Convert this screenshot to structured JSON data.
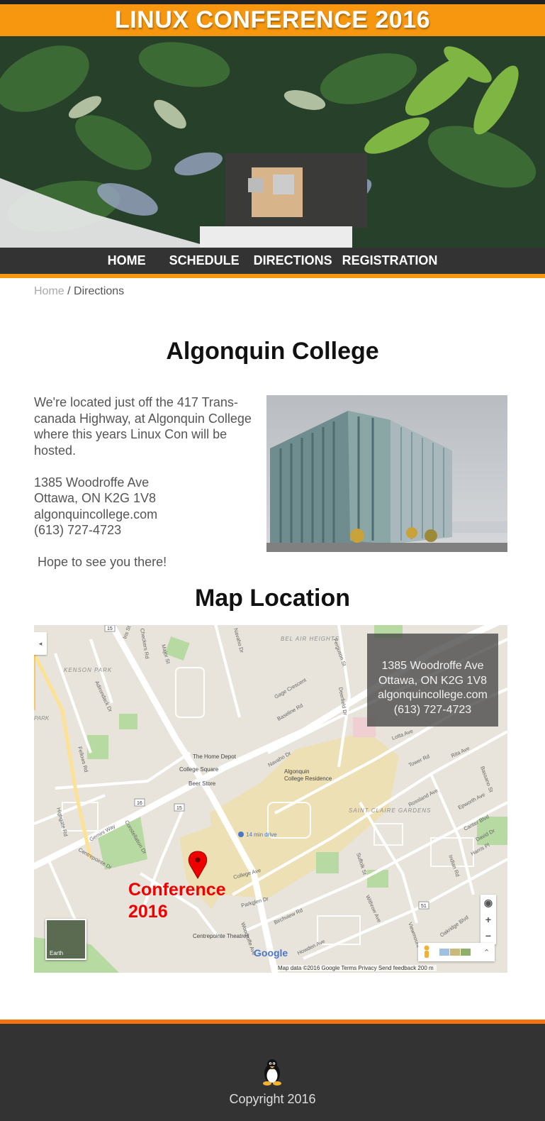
{
  "site": {
    "title": "LINUX CONFERENCE 2016"
  },
  "nav": {
    "items": [
      "HOME",
      "SCHEDULE",
      "DIRECTIONS",
      "REGISTRATION"
    ]
  },
  "breadcrumb": {
    "home": "Home",
    "separator": " / ",
    "current": "Directions"
  },
  "directions": {
    "heading": "Algonquin College",
    "intro": "We're located just off the 417 Trans-canada Highway, at Algonquin College where this years Linux Con will be hosted.",
    "address_lines": [
      "1385 Woodroffe Ave",
      "Ottawa, ON K2G 1V8",
      "algonquincollege.com",
      "(613) 727-4723"
    ],
    "closing": "Hope to see you there!"
  },
  "map_section": {
    "heading": "Map Location",
    "info_lines": [
      "1385 Woodroffe Ave",
      "Ottawa, ON K2G 1V8",
      "algonquincollege.com",
      "(613) 727-4723"
    ],
    "marker_label_line1": "Conference",
    "marker_label_line2": "2016",
    "attribution": "Map data ©2016 Google   Terms   Privacy   Send feedback   200 m",
    "google_label": "Google",
    "earth_label": "Earth",
    "zoom_in": "+",
    "zoom_out": "−",
    "place_labels": {
      "kenson_park": "KENSON PARK",
      "bel_air_heights": "BEL AIR HEIGHTS",
      "saint_claire_gardens": "SAINT CLAIRE GARDENS",
      "home_depot": "The Home Depot",
      "college_square": "College Square",
      "beer_store": "Beer Store",
      "residence_line1": "Algonquin",
      "residence_line2": "College Residence",
      "drive": "14 min drive",
      "centrepointe_theatres": "Centrepointe Theatres",
      "park": "PARK"
    },
    "street_labels": {
      "baseline": "Baseline Rd",
      "woodroffe": "Woodroffe Ave",
      "navaho": "Navaho Dr",
      "navaho_dr2": "Navaho Dr",
      "college_ave": "College Ave",
      "centrepointe": "Centrepointe Dr",
      "constellation": "Constellation Dr",
      "gage": "Gage Crescent",
      "lotta": "Lotta Ave",
      "tower": "Tower Rd",
      "rita": "Rita Ave",
      "rossland": "Rossland Ave",
      "epworth": "Epworth Ave",
      "canter": "Canter Blvd",
      "harris": "Harris Pl",
      "david": "David Dr",
      "suffolk": "Suffolk St",
      "withrow": "Withrow Ave",
      "birchview": "Birchview Rd",
      "parkglen": "Parkglen Dr",
      "howden": "Howden Ave",
      "indian": "Indian Rd",
      "oakridge": "Oakridge Blvd",
      "viewmount": "Viewmount",
      "iris": "Iris St",
      "checkers": "Checkers Rd",
      "major": "Major St",
      "adirondack": "Adirondack Dr",
      "fellows": "Fellows Rd",
      "highgate": "Highgate Rd",
      "gemini": "Gemini Way",
      "deerfield": "Deerfield Dr",
      "ferguson": "Ferguson St",
      "bassano": "Bassano St",
      "route15": "15",
      "route16": "16",
      "route51": "51"
    }
  },
  "footer": {
    "copyright": "Copyright 2016"
  },
  "colors": {
    "accent": "#f6970f",
    "dark": "#333333",
    "marker": "#e00000"
  }
}
